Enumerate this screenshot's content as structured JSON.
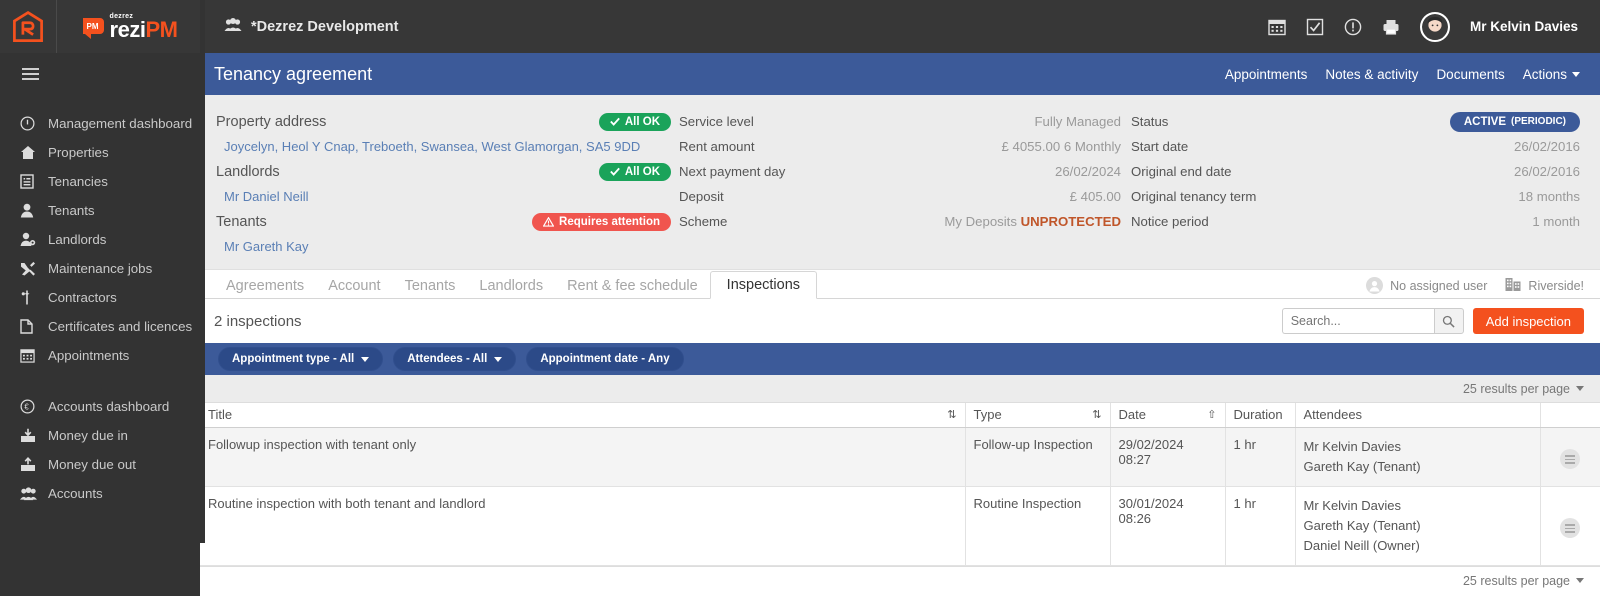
{
  "topbar": {
    "logo_name": "rezi-logo",
    "brand_small": "dezrez",
    "brand_main_white": "rezi",
    "brand_main_orange": "PM",
    "brand_badge": "PM",
    "doc_title": "*Dezrez Development",
    "icons": [
      "calendar-icon",
      "checkbox-icon",
      "alert-icon",
      "printer-icon"
    ],
    "user_name": "Mr Kelvin Davies"
  },
  "sidebar": {
    "menu_toggle": "hamburger-icon",
    "group1": [
      {
        "label": "Management dashboard",
        "icon": "info-circle-icon"
      },
      {
        "label": "Properties",
        "icon": "home-icon"
      },
      {
        "label": "Tenancies",
        "icon": "document-icon"
      },
      {
        "label": "Tenants",
        "icon": "person-icon"
      },
      {
        "label": "Landlords",
        "icon": "person-gear-icon"
      },
      {
        "label": "Maintenance jobs",
        "icon": "tools-icon"
      },
      {
        "label": "Contractors",
        "icon": "wrench-icon"
      },
      {
        "label": "Certificates and licences",
        "icon": "page-icon"
      },
      {
        "label": "Appointments",
        "icon": "calendar-icon"
      }
    ],
    "group2": [
      {
        "label": "Accounts dashboard",
        "icon": "euro-circle-icon"
      },
      {
        "label": "Money due in",
        "icon": "inbox-down-icon"
      },
      {
        "label": "Money due out",
        "icon": "inbox-up-icon"
      },
      {
        "label": "Accounts",
        "icon": "people-icon"
      }
    ]
  },
  "page": {
    "title": "Tenancy agreement",
    "nav": [
      {
        "label": "Appointments"
      },
      {
        "label": "Notes & activity"
      },
      {
        "label": "Documents"
      },
      {
        "label": "Actions",
        "caret": true
      }
    ]
  },
  "summary": {
    "property_address_label": "Property address",
    "property_address_badge": "All OK",
    "property_address_value": "Joycelyn, Heol Y Cnap, Treboeth, Swansea, West Glamorgan, SA5 9DD",
    "landlords_label": "Landlords",
    "landlords_badge": "All OK",
    "landlords_value": "Mr Daniel Neill",
    "tenants_label": "Tenants",
    "tenants_badge": "Requires attention",
    "tenants_value": "Mr Gareth Kay",
    "middle": [
      {
        "key": "Service level",
        "value": "Fully Managed"
      },
      {
        "key": "Rent amount",
        "value": "£ 4055.00 6 Monthly"
      },
      {
        "key": "Next payment day",
        "value": "26/02/2024"
      },
      {
        "key": "Deposit",
        "value": "£ 405.00"
      }
    ],
    "scheme_key": "Scheme",
    "scheme_value": "My Deposits",
    "scheme_status": "UNPROTECTED",
    "status_key": "Status",
    "status_badge_main": "ACTIVE",
    "status_badge_sub": "(PERIODIC)",
    "right": [
      {
        "key": "Start date",
        "value": "26/02/2016"
      },
      {
        "key": "Original end date",
        "value": "26/02/2016"
      },
      {
        "key": "Original tenancy term",
        "value": "18 months"
      },
      {
        "key": "Notice period",
        "value": "1 month"
      }
    ]
  },
  "tabs": [
    {
      "label": "Agreements",
      "active": false
    },
    {
      "label": "Account",
      "active": false
    },
    {
      "label": "Tenants",
      "active": false
    },
    {
      "label": "Landlords",
      "active": false
    },
    {
      "label": "Rent & fee schedule",
      "active": false
    },
    {
      "label": "Inspections",
      "active": true
    }
  ],
  "tabs_right": {
    "assigned_user": "No assigned user",
    "branch": "Riverside!"
  },
  "toolbar": {
    "count_text": "2 inspections",
    "search_placeholder": "Search...",
    "search_value": "",
    "add_label": "Add inspection"
  },
  "filters": [
    {
      "label": "Appointment type - All",
      "caret": true
    },
    {
      "label": "Attendees - All",
      "caret": true
    },
    {
      "label": "Appointment date - Any",
      "caret": false
    }
  ],
  "results_per_page": "25 results per page",
  "table": {
    "columns": [
      "Title",
      "Type",
      "Date",
      "Duration",
      "Attendees"
    ],
    "rows": [
      {
        "title": "Followup inspection with tenant only",
        "type": "Follow-up Inspection",
        "date": "29/02/2024 08:27",
        "duration": "1 hr",
        "attendees": [
          "Mr Kelvin Davies",
          "Gareth Kay (Tenant)"
        ]
      },
      {
        "title": "Routine inspection with both tenant and landlord",
        "type": "Routine Inspection",
        "date": "30/01/2024 08:26",
        "duration": "1 hr",
        "attendees": [
          "Mr Kelvin Davies",
          "Gareth Kay (Tenant)",
          "Daniel Neill (Owner)"
        ]
      }
    ]
  },
  "colors": {
    "brand_orange": "#f4511e",
    "header_dark": "#373737",
    "sidebar_dark": "#333333",
    "accent_blue": "#3c5a99",
    "ok_green": "#1aa35a",
    "warn_red": "#f0554e"
  }
}
